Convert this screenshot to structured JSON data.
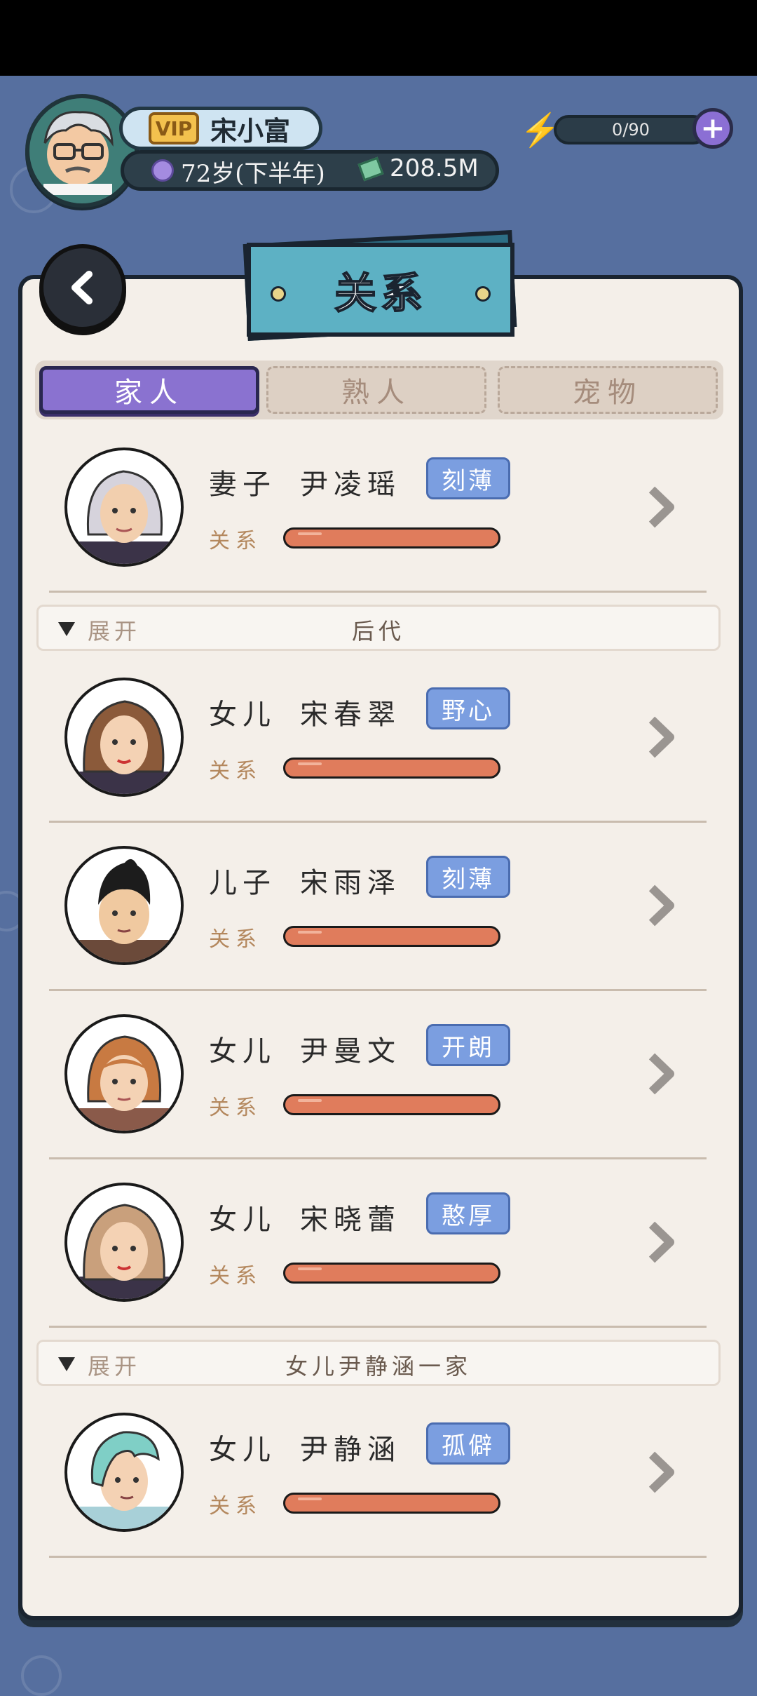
{
  "header": {
    "vip_label": "VIP",
    "username": "宋小富",
    "age": "72岁(下半年)",
    "money": "208.5M",
    "energy": "0/90"
  },
  "title": "关系",
  "tabs": [
    {
      "label": "家人",
      "active": true
    },
    {
      "label": "熟人",
      "active": false
    },
    {
      "label": "宠物",
      "active": false
    }
  ],
  "relationship_label": "关系",
  "expand_label": "展开",
  "spouse": {
    "relation": "妻子",
    "name": "尹凌瑶",
    "trait": "刻薄"
  },
  "sections": [
    {
      "title": "后代"
    },
    {
      "title": "女儿尹静涵一家"
    }
  ],
  "children": [
    {
      "relation": "女儿",
      "name": "宋春翠",
      "trait": "野心"
    },
    {
      "relation": "儿子",
      "name": "宋雨泽",
      "trait": "刻薄"
    },
    {
      "relation": "女儿",
      "name": "尹曼文",
      "trait": "开朗"
    },
    {
      "relation": "女儿",
      "name": "宋晓蕾",
      "trait": "憨厚"
    }
  ],
  "grandfamily": [
    {
      "relation": "女儿",
      "name": "尹静涵",
      "trait": "孤僻"
    }
  ],
  "colors": {
    "background": "#566f9f",
    "card": "#f4efe9",
    "tab_active": "#8a72d0",
    "trait_badge": "#7b9ee0",
    "relationship_bar": "#e07c5c",
    "title_banner": "#5db1c4"
  }
}
